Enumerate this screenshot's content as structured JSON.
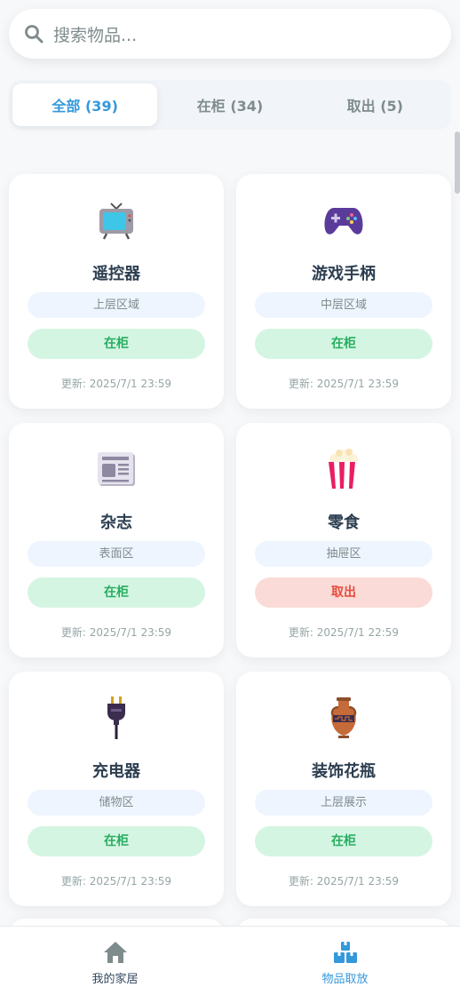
{
  "search": {
    "placeholder": "搜索物品..."
  },
  "tabs": [
    {
      "label": "全部 (39)",
      "active": true
    },
    {
      "label": "在柜 (34)",
      "active": false
    },
    {
      "label": "取出 (5)",
      "active": false
    }
  ],
  "items": [
    {
      "icon": "tv-icon",
      "name": "遥控器",
      "location": "上层区域",
      "status": "在柜",
      "updated": "更新: 2025/7/1 23:59"
    },
    {
      "icon": "gamepad-icon",
      "name": "游戏手柄",
      "location": "中层区域",
      "status": "在柜",
      "updated": "更新: 2025/7/1 23:59"
    },
    {
      "icon": "newspaper-icon",
      "name": "杂志",
      "location": "表面区",
      "status": "在柜",
      "updated": "更新: 2025/7/1 23:59"
    },
    {
      "icon": "popcorn-icon",
      "name": "零食",
      "location": "抽屉区",
      "status": "取出",
      "updated": "更新: 2025/7/1 22:59"
    },
    {
      "icon": "plug-icon",
      "name": "充电器",
      "location": "储物区",
      "status": "在柜",
      "updated": "更新: 2025/7/1 23:59"
    },
    {
      "icon": "vase-icon",
      "name": "装饰花瓶",
      "location": "上层展示",
      "status": "在柜",
      "updated": "更新: 2025/7/1 23:59"
    }
  ],
  "bottom_nav": [
    {
      "icon": "home-icon",
      "label": "我的家居",
      "active": false
    },
    {
      "icon": "boxes-icon",
      "label": "物品取放",
      "active": true
    }
  ],
  "colors": {
    "accent": "#3498db",
    "in_bg": "#d5f5e3",
    "in_text": "#27ae60",
    "out_bg": "#fadbd8",
    "out_text": "#e74c3c"
  }
}
